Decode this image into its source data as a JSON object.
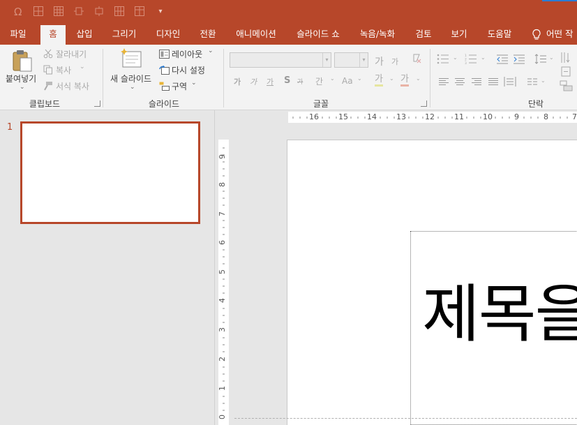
{
  "quick_access": {
    "icons": [
      "omega-icon",
      "table-icon",
      "table-grid-icon",
      "align-icon",
      "distribute-icon",
      "table-insert-icon",
      "table-split-icon",
      "customize-dropdown-icon"
    ]
  },
  "tabs": [
    {
      "label": "파일"
    },
    {
      "label": "홈"
    },
    {
      "label": "삽입"
    },
    {
      "label": "그리기"
    },
    {
      "label": "디자인"
    },
    {
      "label": "전환"
    },
    {
      "label": "애니메이션"
    },
    {
      "label": "슬라이드 쇼"
    },
    {
      "label": "녹음/녹화"
    },
    {
      "label": "검토"
    },
    {
      "label": "보기"
    },
    {
      "label": "도움말"
    },
    {
      "label": "어떤 작"
    }
  ],
  "ribbon": {
    "clipboard": {
      "paste": "붙여넣기",
      "cut": "잘라내기",
      "copy": "복사",
      "format_painter": "서식 복사",
      "label": "클립보드"
    },
    "slides": {
      "new_slide": "새 슬라이드",
      "layout": "레이아웃",
      "reset": "다시 설정",
      "section": "구역",
      "label": "슬라이드"
    },
    "font": {
      "font_name": "",
      "font_size": "",
      "label": "글꼴",
      "glyph_grow": "가",
      "glyph_shrink": "가",
      "bold": "가",
      "italic": "가",
      "underline": "가",
      "shadow": "S",
      "strike": "가",
      "spacing": "간",
      "case": "Aa",
      "highlight": "가",
      "color": "가"
    },
    "paragraph": {
      "label": "단락"
    }
  },
  "slides_pane": {
    "slide_number": "1"
  },
  "rulers": {
    "horizontal": [
      "16",
      "15",
      "14",
      "13",
      "12",
      "11",
      "10",
      "9",
      "8",
      "7"
    ],
    "vertical": [
      "9",
      "8",
      "7",
      "6",
      "5",
      "4",
      "3",
      "2",
      "1",
      "0"
    ]
  },
  "slide": {
    "title_text": "제목을"
  },
  "colors": {
    "accent": "#b7472a",
    "ribbon_bg": "#f3f3f3",
    "workspace_bg": "#e6e6e6"
  }
}
